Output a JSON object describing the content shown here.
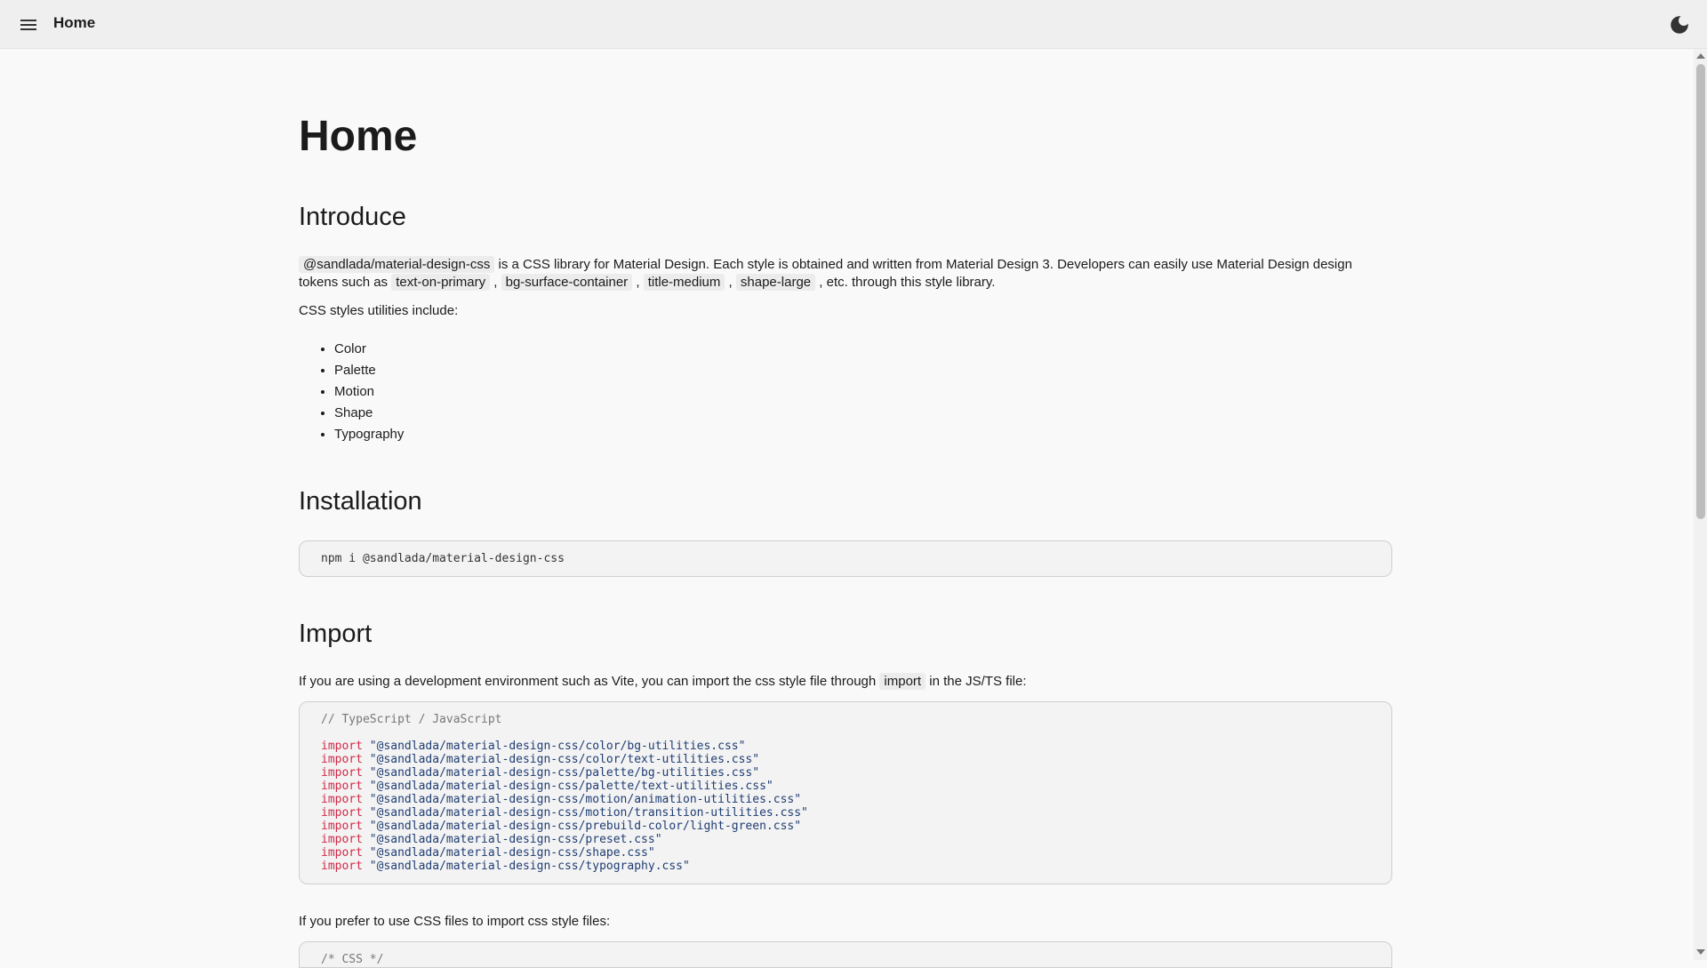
{
  "topbar": {
    "title": "Home"
  },
  "page": {
    "heading": "Home",
    "introduce": {
      "heading": "Introduce",
      "p1_code1": "@sandlada/material-design-css",
      "p1_text1": " is a CSS library for Material Design. Each style is obtained and written from Material Design 3. Developers can easily use Material Design design tokens such as ",
      "tokens": [
        "text-on-primary",
        "bg-surface-container",
        "title-medium",
        "shape-large"
      ],
      "sep": " , ",
      "p1_text2": " , etc. through this style library.",
      "p2": "CSS styles utilities include:",
      "features": [
        "Color",
        "Palette",
        "Motion",
        "Shape",
        "Typography"
      ]
    },
    "installation": {
      "heading": "Installation",
      "command": "npm i @sandlada/material-design-css"
    },
    "import": {
      "heading": "Import",
      "p1_text1": "If you are using a development environment such as Vite, you can import the css style file through ",
      "p1_code": "import",
      "p1_text2": " in the JS/TS file:",
      "code_comment": "// TypeScript / JavaScript",
      "keyword": "import",
      "paths": [
        "\"@sandlada/material-design-css/color/bg-utilities.css\"",
        "\"@sandlada/material-design-css/color/text-utilities.css\"",
        "\"@sandlada/material-design-css/palette/bg-utilities.css\"",
        "\"@sandlada/material-design-css/palette/text-utilities.css\"",
        "\"@sandlada/material-design-css/motion/animation-utilities.css\"",
        "\"@sandlada/material-design-css/motion/transition-utilities.css\"",
        "\"@sandlada/material-design-css/prebuild-color/light-green.css\"",
        "\"@sandlada/material-design-css/preset.css\"",
        "\"@sandlada/material-design-css/shape.css\"",
        "\"@sandlada/material-design-css/typography.css\""
      ],
      "p2": "If you prefer to use CSS files to import css style files:",
      "css_comment": "/* CSS */"
    }
  },
  "icons": {
    "menu": "menu-icon",
    "theme": "dark-mode-icon"
  }
}
